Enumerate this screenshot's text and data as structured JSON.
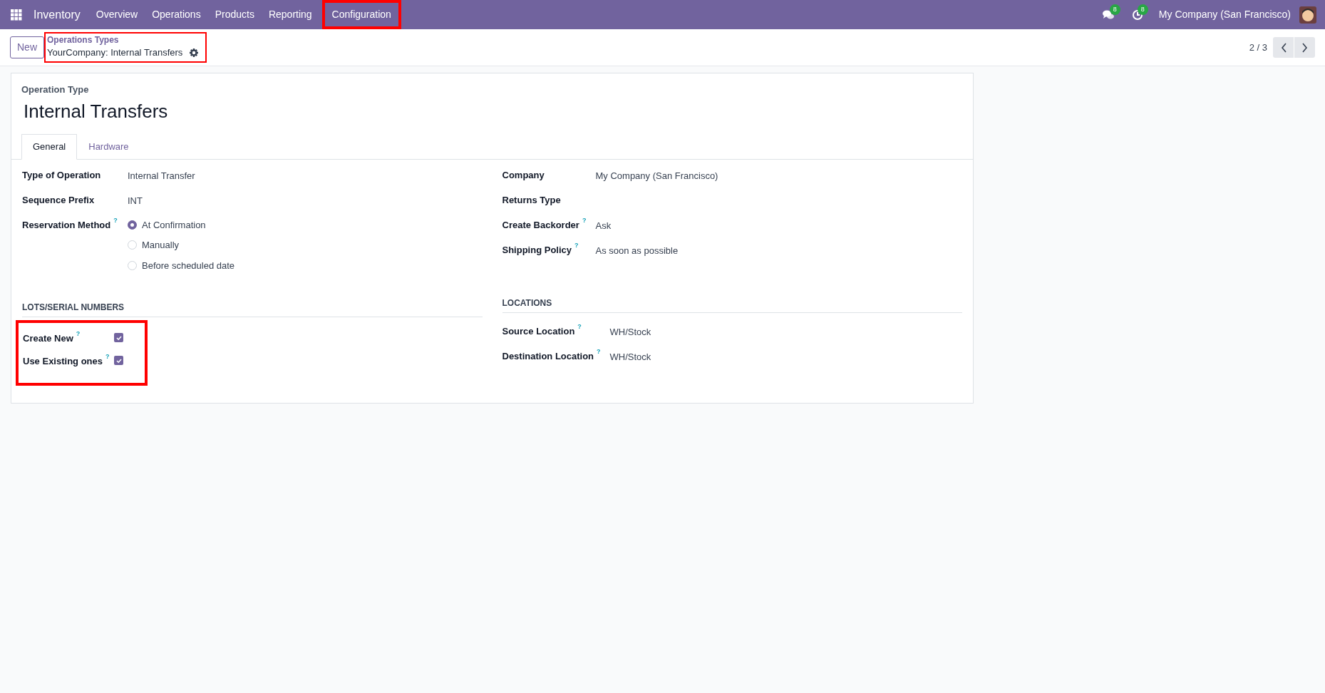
{
  "navbar": {
    "app_name": "Inventory",
    "menu": [
      {
        "label": "Overview",
        "highlighted": false
      },
      {
        "label": "Operations",
        "highlighted": false
      },
      {
        "label": "Products",
        "highlighted": false
      },
      {
        "label": "Reporting",
        "highlighted": false
      },
      {
        "label": "Configuration",
        "highlighted": true
      }
    ],
    "messages_badge": "8",
    "activities_badge": "8",
    "company": "My Company (San Francisco)"
  },
  "control_panel": {
    "new_button": "New",
    "breadcrumb": {
      "parent": "Operations Types",
      "current": "YourCompany: Internal Transfers",
      "highlighted": true
    },
    "pager": "2 / 3"
  },
  "form": {
    "caption": "Operation Type",
    "title": "Internal Transfers",
    "tabs": [
      {
        "label": "General",
        "selected": true
      },
      {
        "label": "Hardware",
        "selected": false
      }
    ],
    "left_fields": [
      {
        "label": "Type of Operation",
        "value": "Internal Transfer"
      },
      {
        "label": "Sequence Prefix",
        "value": "INT"
      },
      {
        "label": "Reservation Method",
        "help": "?",
        "options": [
          {
            "label": "At Confirmation",
            "selected": true
          },
          {
            "label": "Manually",
            "selected": false
          },
          {
            "label": "Before scheduled date",
            "selected": false
          }
        ]
      }
    ],
    "right_fields": [
      {
        "label": "Company",
        "value": "My Company (San Francisco)"
      },
      {
        "label": "Returns Type"
      },
      {
        "label": "Create Backorder",
        "help": "?",
        "value": "Ask"
      },
      {
        "label": "Shipping Policy",
        "help": "?",
        "value": "As soon as possible"
      }
    ],
    "lots_section": {
      "title": "LOTS/SERIAL NUMBERS",
      "highlighted": true,
      "fields": [
        {
          "label": "Create New",
          "help": "?",
          "checked": true
        },
        {
          "label": "Use Existing ones",
          "help": "?",
          "checked": true
        }
      ]
    },
    "locations_section": {
      "title": "LOCATIONS",
      "fields": [
        {
          "label": "Source Location",
          "help": "?",
          "value": "WH/Stock"
        },
        {
          "label": "Destination Location",
          "help": "?",
          "value": "WH/Stock"
        }
      ]
    }
  }
}
